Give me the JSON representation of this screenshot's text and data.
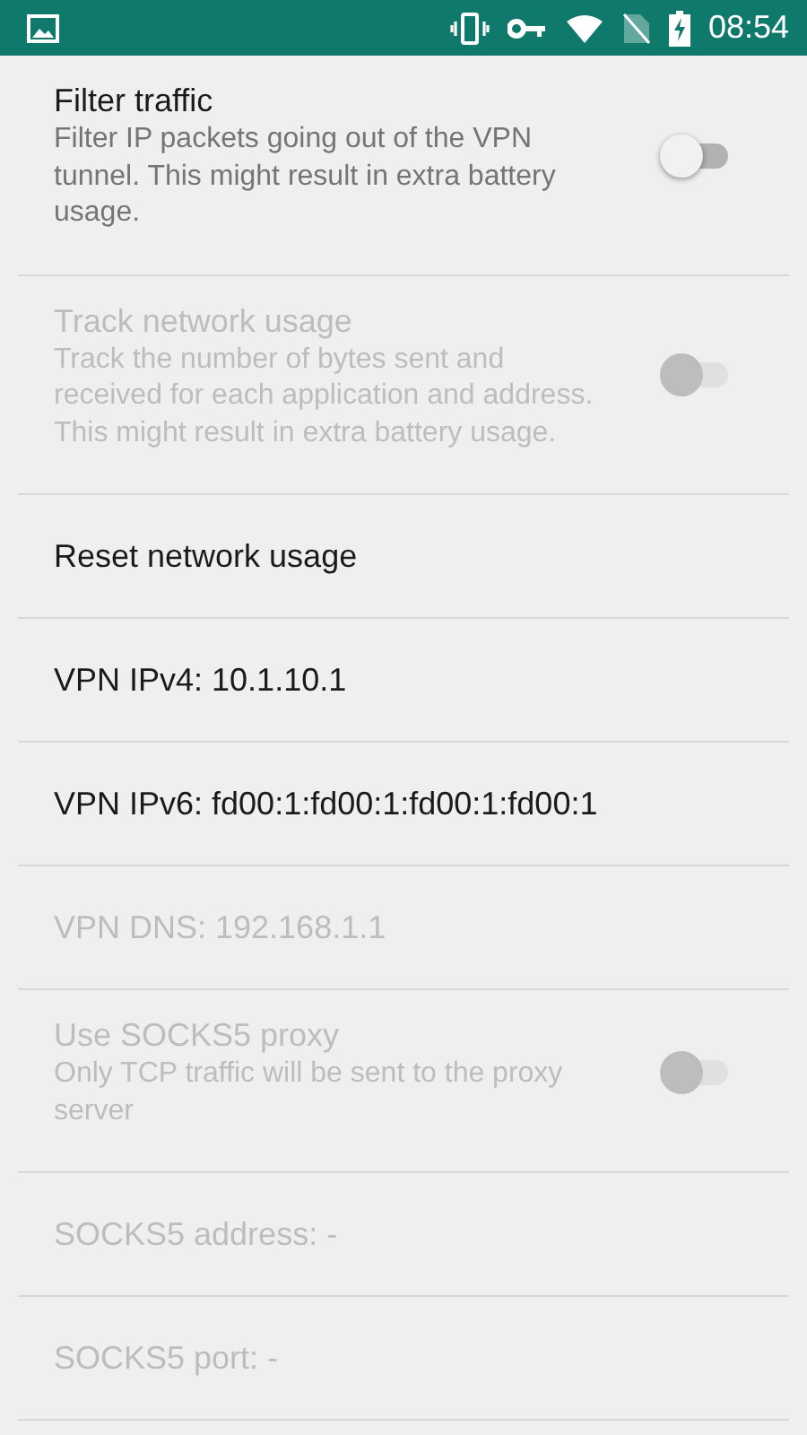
{
  "status_bar": {
    "time": "08:54"
  },
  "settings": [
    {
      "kind": "switch",
      "title": "Filter traffic",
      "summary": "Filter IP packets going out of the VPN tunnel. This might result in extra battery usage.",
      "on": false,
      "disabled": false
    },
    {
      "kind": "switch",
      "title": "Track network usage",
      "summary": "Track the number of bytes sent and received for each application and address. This might result in extra battery usage.",
      "on": false,
      "disabled": true
    },
    {
      "kind": "plain",
      "title": "Reset network usage",
      "disabled": false
    },
    {
      "kind": "plain",
      "title": "VPN IPv4: 10.1.10.1",
      "disabled": false
    },
    {
      "kind": "plain",
      "title": "VPN IPv6: fd00:1:fd00:1:fd00:1:fd00:1",
      "disabled": false
    },
    {
      "kind": "plain",
      "title": "VPN DNS: 192.168.1.1",
      "disabled": true
    },
    {
      "kind": "switch",
      "title": "Use SOCKS5 proxy",
      "summary": "Only TCP traffic will be sent to the proxy server",
      "on": false,
      "disabled": true
    },
    {
      "kind": "plain",
      "title": "SOCKS5 address: -",
      "disabled": true
    },
    {
      "kind": "plain",
      "title": "SOCKS5 port: -",
      "disabled": true
    }
  ]
}
